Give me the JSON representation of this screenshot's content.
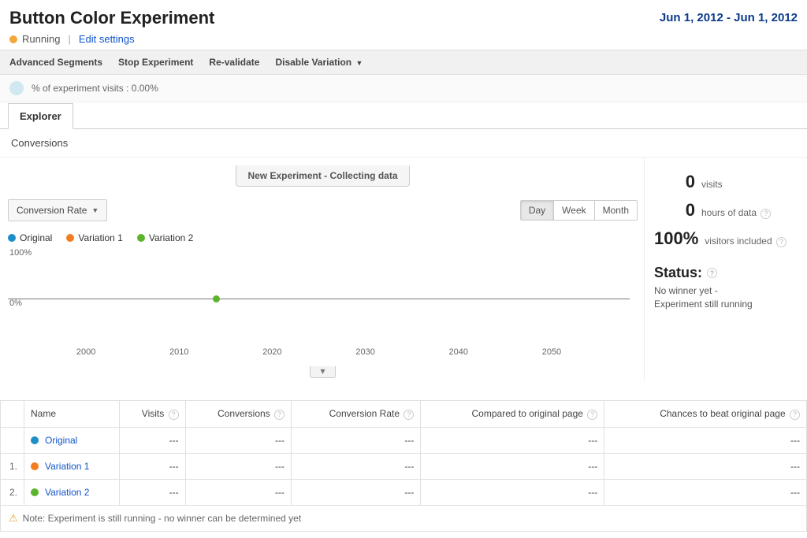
{
  "header": {
    "title": "Button Color Experiment",
    "status_label": "Running",
    "edit_link": "Edit settings",
    "date_range": "Jun 1, 2012 - Jun 1, 2012"
  },
  "toolbar": {
    "advanced_segments": "Advanced Segments",
    "stop": "Stop Experiment",
    "revalidate": "Re-validate",
    "disable_variation": "Disable Variation"
  },
  "visits_bar": "% of experiment visits : 0.00%",
  "tabs": {
    "explorer": "Explorer"
  },
  "subrow": {
    "conversions": "Conversions"
  },
  "banner": "New Experiment - Collecting data",
  "dropdown": {
    "conversion_rate": "Conversion Rate"
  },
  "time": {
    "day": "Day",
    "week": "Week",
    "month": "Month"
  },
  "legend": {
    "original": "Original",
    "var1": "Variation 1",
    "var2": "Variation 2"
  },
  "chart_data": {
    "type": "line",
    "title": "",
    "ylabel": "",
    "xlabel": "",
    "ylim": [
      0,
      100
    ],
    "y_ticks": [
      "100%",
      "0%"
    ],
    "x_ticks": [
      "2000",
      "2010",
      "2020",
      "2030",
      "2040",
      "2050"
    ],
    "series": [
      {
        "name": "Original",
        "values": [
          0,
          0,
          0,
          0,
          0,
          0
        ]
      },
      {
        "name": "Variation 1",
        "values": [
          0,
          0,
          0,
          0,
          0,
          0
        ]
      },
      {
        "name": "Variation 2",
        "values": [
          0,
          0,
          0,
          0,
          0,
          0
        ]
      }
    ]
  },
  "stats": {
    "visits_num": "0",
    "visits_label": "visits",
    "hours_num": "0",
    "hours_label": "hours of data",
    "included_num": "100%",
    "included_label": "visitors included"
  },
  "status_block": {
    "heading": "Status:",
    "line1": "No winner yet -",
    "line2": "Experiment still running"
  },
  "table": {
    "headers": {
      "name": "Name",
      "visits": "Visits",
      "conversions": "Conversions",
      "rate": "Conversion Rate",
      "compared": "Compared to original page",
      "chances": "Chances to beat original page"
    },
    "rows": [
      {
        "num": "",
        "color": "#1c8ec8",
        "name": "Original",
        "visits": "---",
        "conversions": "---",
        "rate": "---",
        "compared": "---",
        "chances": "---"
      },
      {
        "num": "1.",
        "color": "#f47b20",
        "name": "Variation 1",
        "visits": "---",
        "conversions": "---",
        "rate": "---",
        "compared": "---",
        "chances": "---"
      },
      {
        "num": "2.",
        "color": "#5cb42c",
        "name": "Variation 2",
        "visits": "---",
        "conversions": "---",
        "rate": "---",
        "compared": "---",
        "chances": "---"
      }
    ],
    "note": "Note: Experiment is still running - no winner can be determined yet"
  }
}
